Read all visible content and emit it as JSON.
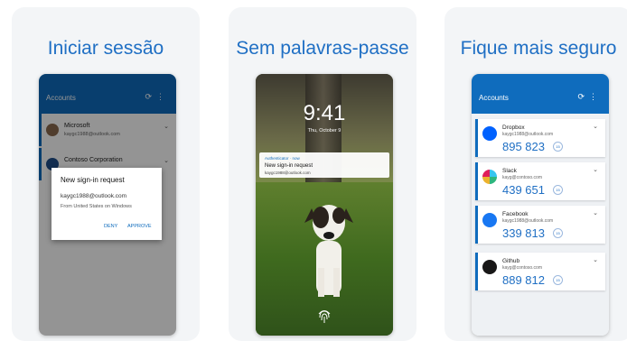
{
  "panels": [
    {
      "title": "Iniciar sessão",
      "app_title": "Accounts",
      "accounts": [
        {
          "name": "Microsoft",
          "email": "kaygc1988@outlook.com"
        },
        {
          "name": "Contoso Corporation",
          "email": ""
        }
      ],
      "dialog": {
        "title": "New sign-in request",
        "email": "kaygc1988@outlook.com",
        "from": "From United States on Windows",
        "deny": "DENY",
        "approve": "APPROVE"
      }
    },
    {
      "title": "Sem palavras-passe",
      "time": "9:41",
      "date": "Thu, October 9",
      "notification": {
        "app": "Authenticator · now",
        "title": "New sign-in request",
        "email": "kaygc1988@outlook.com"
      }
    },
    {
      "title": "Fique mais seguro",
      "app_title": "Accounts",
      "accounts": [
        {
          "name": "Dropbox",
          "email": "kaygc1988@outlook.com",
          "code": "895 823",
          "timer": "15"
        },
        {
          "name": "Slack",
          "email": "kayg@contoso.com",
          "code": "439 651",
          "timer": "15"
        },
        {
          "name": "Facebook",
          "email": "kaygc1988@outlook.com",
          "code": "339 813",
          "timer": "15"
        },
        {
          "name": "Github",
          "email": "kayg@contoso.com",
          "code": "889 812",
          "timer": "15"
        }
      ]
    }
  ],
  "colors": {
    "accent": "#0f6cbd",
    "title": "#1f6fc4"
  }
}
